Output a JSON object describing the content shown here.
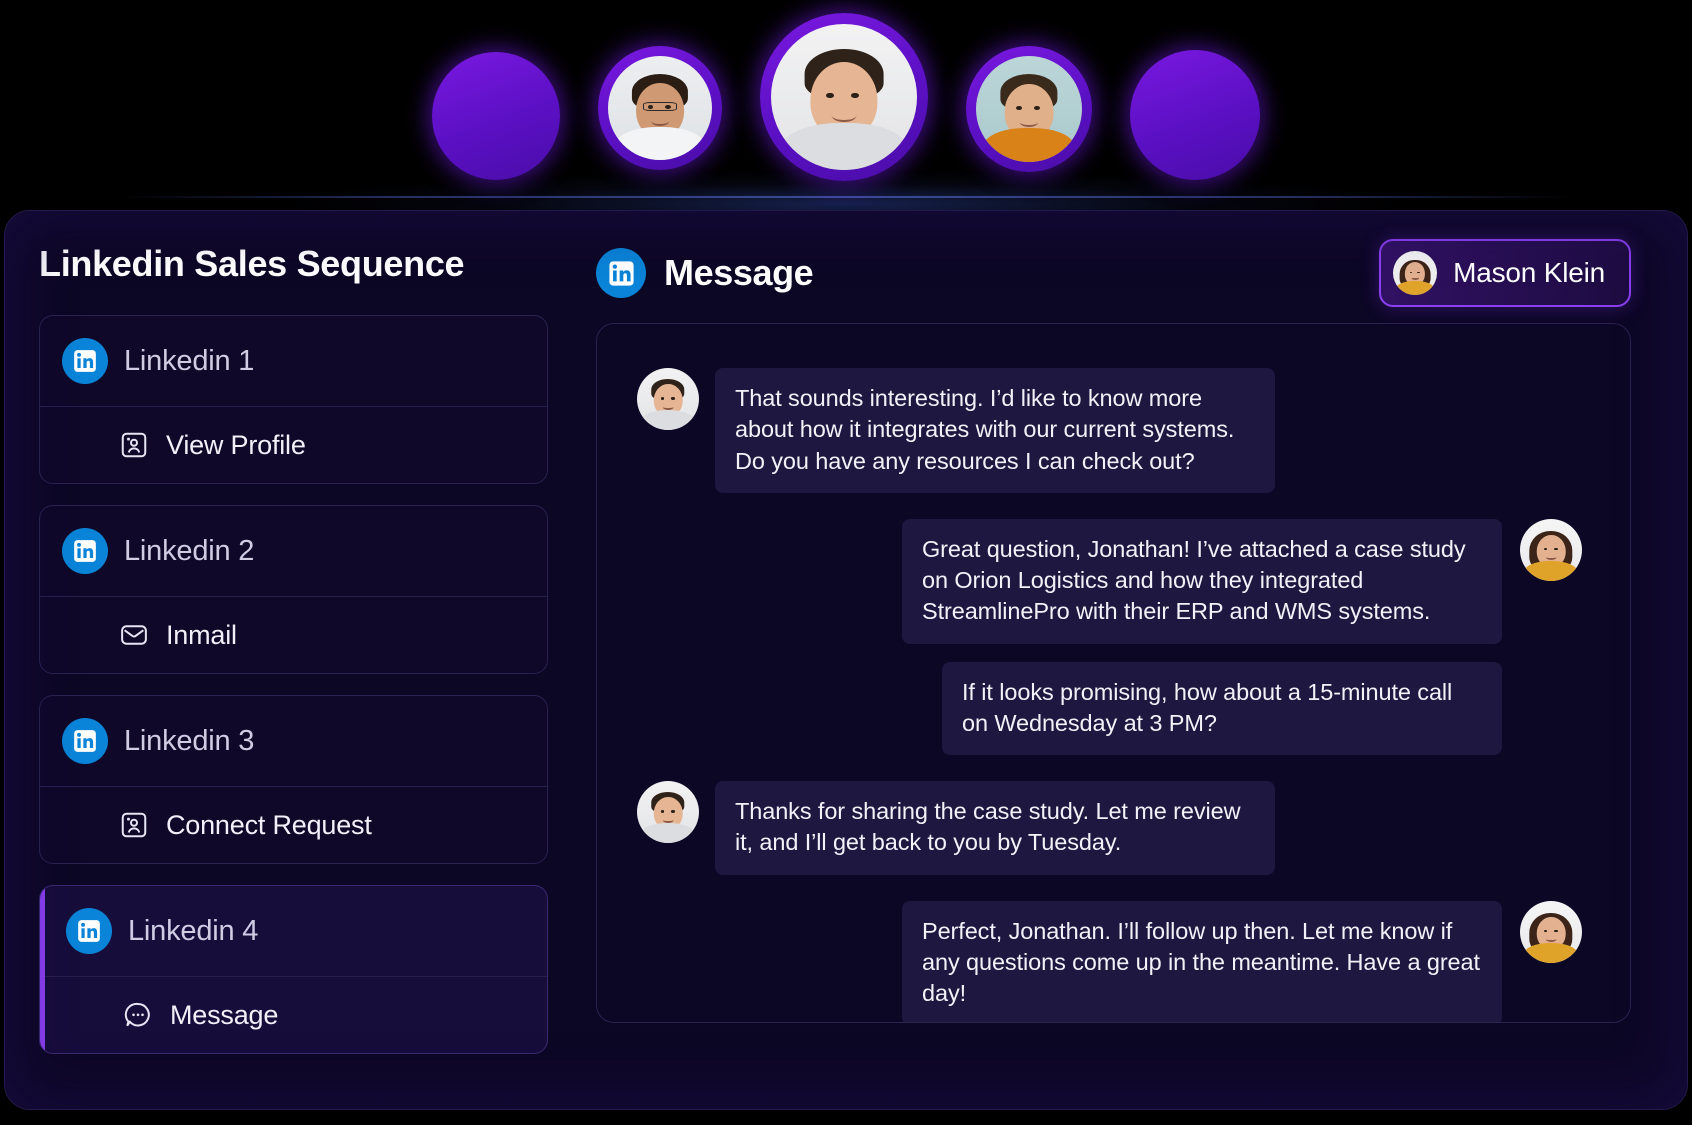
{
  "top_avatars": [
    {
      "name": "avatar-placeholder-left",
      "type": "placeholder"
    },
    {
      "name": "avatar-woman-glasses",
      "type": "photo"
    },
    {
      "name": "avatar-man-center",
      "type": "photo"
    },
    {
      "name": "avatar-man-orange",
      "type": "photo"
    },
    {
      "name": "avatar-placeholder-right",
      "type": "placeholder"
    }
  ],
  "sidebar": {
    "title": "Linkedin Sales Sequence",
    "steps": [
      {
        "name": "Linkedin 1",
        "action": "View Profile",
        "action_icon": "profile-card-icon",
        "active": false
      },
      {
        "name": "Linkedin 2",
        "action": "Inmail",
        "action_icon": "envelope-icon",
        "active": false
      },
      {
        "name": "Linkedin 3",
        "action": "Connect Request",
        "action_icon": "add-person-icon",
        "active": false
      },
      {
        "name": "Linkedin 4",
        "action": "Message",
        "action_icon": "chat-bubble-icon",
        "active": true
      }
    ]
  },
  "chat": {
    "header_icon": "linkedin-icon",
    "title": "Message",
    "user_chip": {
      "name": "Mason Klein",
      "avatar": "avatar-woman-orange"
    },
    "messages": [
      {
        "side": "in",
        "avatar": "avatar-man",
        "text": "That sounds interesting. I’d like to know more about how it integrates with our current systems. Do you have any resources I can check out?"
      },
      {
        "side": "out",
        "avatar": "avatar-woman-orange",
        "text": "Great question, Jonathan! I’ve attached a case study on Orion Logistics and how they integrated StreamlinePro with their ERP and WMS systems."
      },
      {
        "side": "out",
        "avatar": null,
        "text": "If it looks promising, how about a 15-minute call on Wednesday at 3 PM?"
      },
      {
        "side": "in",
        "avatar": "avatar-man",
        "text": "Thanks for sharing the case study. Let me review it, and I’ll get back to you by Tuesday."
      },
      {
        "side": "out",
        "avatar": "avatar-woman-orange",
        "text": "Perfect, Jonathan. I’ll follow up then. Let me know if any questions come up in the meantime. Have a great day!"
      }
    ]
  },
  "colors": {
    "background": "#000000",
    "panel": "#0d0726",
    "accent_purple": "#8b3ff0",
    "linkedin_blue": "#0a84d8",
    "bubble": "#1e1840",
    "border": "#2a2250"
  }
}
